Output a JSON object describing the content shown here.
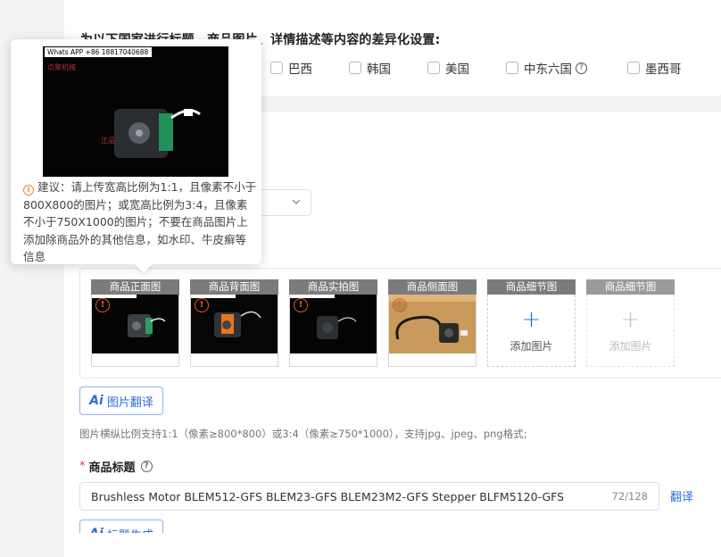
{
  "settings": {
    "title": "为以下国家进行标题、商品图片、详情描述等内容的差异化设置:",
    "countries": [
      {
        "label": "巴西",
        "checked": false
      },
      {
        "label": "韩国",
        "checked": false
      },
      {
        "label": "美国",
        "checked": false
      },
      {
        "label": "中东六国",
        "checked": false,
        "help": true
      },
      {
        "label": "墨西哥",
        "checked": false
      }
    ]
  },
  "tooltip": {
    "photo_watermark": "Whats APP +86 18817040688",
    "photo_text_a": "点聚机械",
    "photo_text_b": "正品",
    "advice": "建议：请上传宽高比例为1:1，且像素不小于800X800的图片；或宽高比例为3:4，且像素不小于750X1000的图片；不要在商品图片上添加除商品外的其他信息，如水印、牛皮癣等信息"
  },
  "images": {
    "slots": [
      {
        "label": "商品正面图",
        "has_image": true,
        "warning": true
      },
      {
        "label": "商品背面图",
        "has_image": true,
        "warning": true
      },
      {
        "label": "商品实拍图",
        "has_image": true,
        "warning": true
      },
      {
        "label": "商品侧面图",
        "has_image": true,
        "warning": true
      },
      {
        "label": "商品细节图",
        "has_image": false,
        "add_label": "添加图片",
        "enabled": true
      },
      {
        "label": "商品细节图",
        "has_image": false,
        "add_label": "添加图片",
        "enabled": false
      }
    ],
    "translate_button": "图片翻译",
    "ai_glyph": "Ai",
    "hint": "图片横纵比例支持1:1（像素≥800*800）或3:4（像素≥750*1000），支持jpg、jpeg、png格式;"
  },
  "product_title": {
    "label": "商品标题",
    "required_mark": "*",
    "value": "Brushless Motor BLEM512-GFS BLEM23-GFS BLEM23M2-GFS Stepper BLFM5120-GFS",
    "count": "72/128",
    "translate_link": "翻译",
    "generate_button": "标题生成"
  },
  "colors": {
    "accent": "#2b6de0",
    "warning": "#e85a2a",
    "slot_label_bg": "#7b7b7b"
  }
}
